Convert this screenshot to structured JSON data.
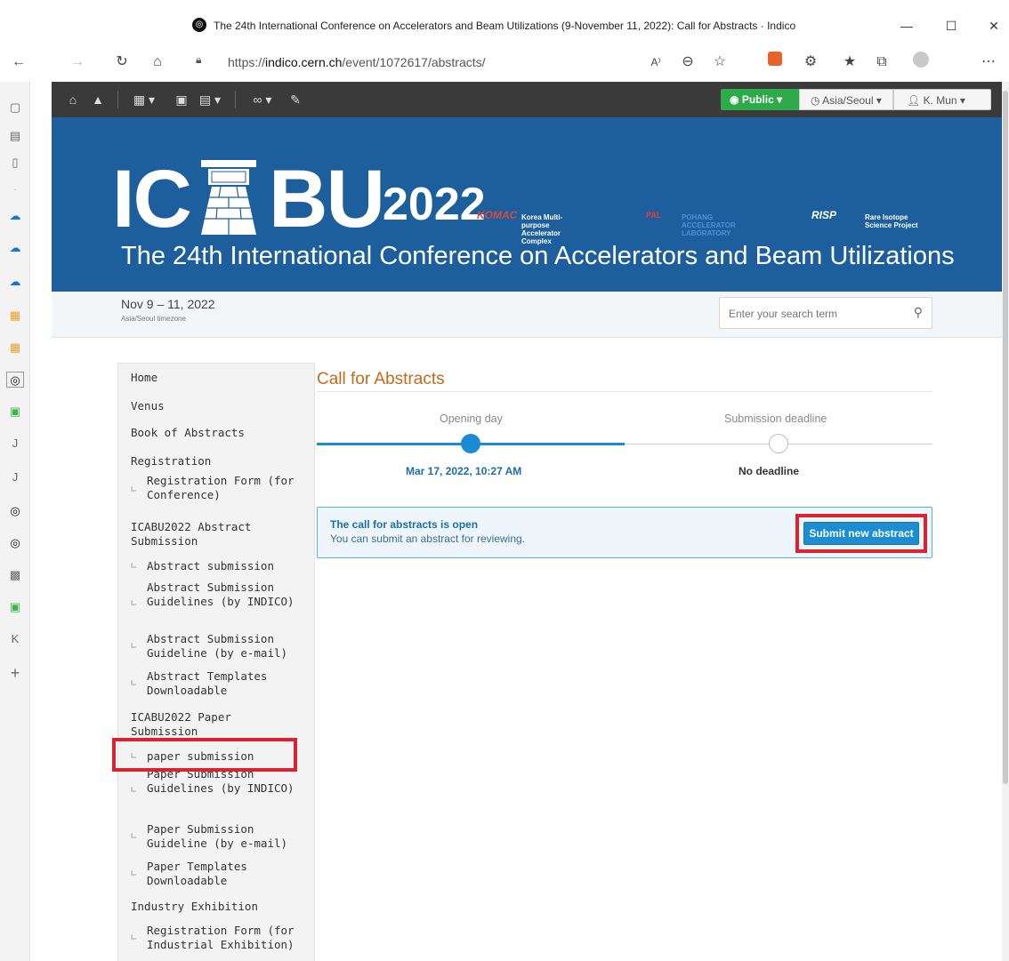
{
  "browser": {
    "window_title": "The 24th International Conference on Accelerators and Beam Utilizations (9-November 11, 2022): Call for Abstracts · Indico",
    "url_prefix": "https://",
    "url_host": "indico.cern.ch",
    "url_path": "/event/1072617/abstracts/",
    "reader_label": "A⁾"
  },
  "toolbar": {
    "public_label": "Public",
    "timezone_label": "Asia/Seoul",
    "user_label": "K. Mun"
  },
  "banner": {
    "logo_left": "IC",
    "logo_right": "BU",
    "logo_year": "2022",
    "title": "The 24th International Conference on Accelerators and Beam Utilizations",
    "partners": [
      {
        "name": "KOMAC",
        "desc": "Korea Multi-purpose Accelerator Complex"
      },
      {
        "name": "PAL",
        "desc": "POHANG ACCELERATOR LABORATORY"
      },
      {
        "name": "RISP",
        "desc": "Rare Isotope Science Project"
      }
    ]
  },
  "datebar": {
    "dates": "Nov 9 – 11, 2022",
    "timezone": "Asia/Seoul timezone",
    "search_placeholder": "Enter your search term"
  },
  "menu": {
    "home": "Home",
    "venus": "Venus",
    "book": "Book of Abstracts",
    "registration": "Registration",
    "reg_form": "Registration Form (for Conference)",
    "abstract_sub": "ICABU2022 Abstract Submission",
    "abstract_submission": "Abstract submission",
    "abstract_guidelines_indico": "Abstract Submission Guidelines (by INDICO)",
    "abstract_guideline_email": "Abstract Submission Guideline (by e-mail)",
    "abstract_templates": "Abstract Templates Downloadable",
    "paper_sub": "ICABU2022 Paper Submission",
    "paper_submission": "paper submission",
    "paper_guidelines_indico": "Paper Submission Guidelines (by INDICO)",
    "paper_guideline_email": "Paper Submission Guideline (by e-mail)",
    "paper_templates": "Paper Templates Downloadable",
    "industry": "Industry Exhibition",
    "industry_form": "Registration Form (for Industrial Exhibition)"
  },
  "content": {
    "title": "Call for Abstracts",
    "opening_label": "Opening day",
    "deadline_label": "Submission deadline",
    "opening_date": "Mar 17, 2022, 10:27 AM",
    "deadline_date": "No deadline",
    "info_title": "The call for abstracts is open",
    "info_body": "You can submit an abstract for reviewing.",
    "submit_label": "Submit new abstract"
  },
  "colors": {
    "banner": "#1c5f9c",
    "accent": "#1a8ed1",
    "title_orange": "#c26b1a",
    "highlight_red": "#d9232e",
    "public_green": "#2eaa4a"
  }
}
